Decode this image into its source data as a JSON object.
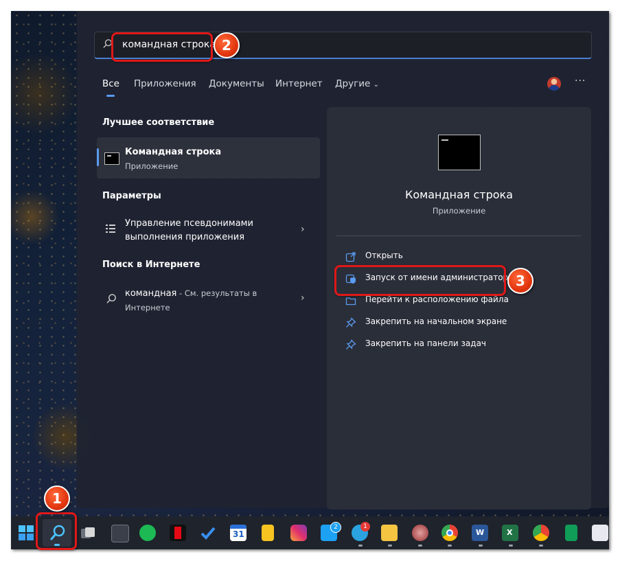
{
  "search": {
    "query": "командная строка"
  },
  "tabs": [
    {
      "label": "Все"
    },
    {
      "label": "Приложения"
    },
    {
      "label": "Документы"
    },
    {
      "label": "Интернет"
    },
    {
      "label": "Другие"
    }
  ],
  "more_label": "···",
  "sections": {
    "best_match": "Лучшее соответствие",
    "settings": "Параметры",
    "web": "Поиск в Интернете"
  },
  "best_match": {
    "title": "Командная строка",
    "subtitle": "Приложение"
  },
  "settings_item": {
    "line1": "Управление псевдонимами",
    "line2": "выполнения приложения"
  },
  "web_item": {
    "query": "командная",
    "suffix": " - См. результаты в",
    "line2": "Интернете"
  },
  "detail": {
    "title": "Командная строка",
    "subtitle": "Приложение",
    "actions": [
      {
        "label": "Открыть",
        "icon": "open-icon"
      },
      {
        "label": "Запуск от имени администратора",
        "icon": "shield-icon"
      },
      {
        "label": "Перейти к расположению файла",
        "icon": "folder-icon"
      },
      {
        "label": "Закрепить на начальном экране",
        "icon": "pin-icon"
      },
      {
        "label": "Закрепить на панели задач",
        "icon": "pin-icon"
      }
    ]
  },
  "badges": {
    "one": "1",
    "two": "2",
    "three": "3"
  },
  "taskbar": {
    "calendar_day": "31",
    "twitter_count": "2",
    "telegram_count": "1"
  },
  "colors": {
    "accent": "#5b9bf0",
    "highlight": "#e01818",
    "panel": "#202431"
  }
}
